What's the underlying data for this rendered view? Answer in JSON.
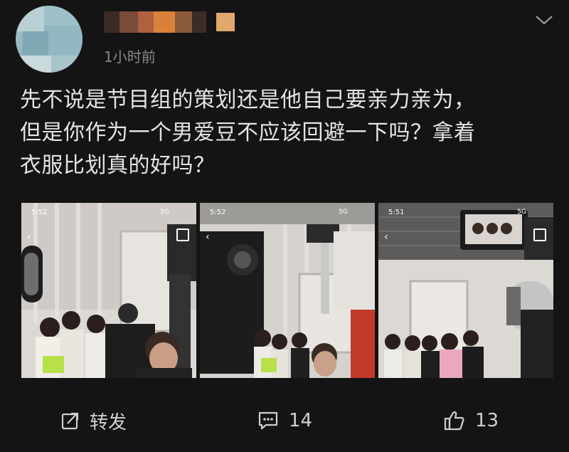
{
  "post": {
    "time": "1小时前",
    "text_lines": [
      "先不说是节目组的策划还是他自己要亲力亲为，",
      "但是你作为一个男爱豆不应该回避一下吗？拿着",
      "衣服比划真的好吗？"
    ]
  },
  "photos": [
    {
      "status_time": "5:52",
      "signal": "5G"
    },
    {
      "status_time": "5:52",
      "signal": "5G"
    },
    {
      "status_time": "5:51",
      "signal": "5G"
    }
  ],
  "actions": {
    "repost_label": "转发",
    "comment_count": "14",
    "like_count": "13"
  },
  "icons": {
    "chevron": "chevron-down-icon",
    "repost": "repost-icon",
    "comment": "comment-icon",
    "like": "thumbs-up-icon"
  },
  "colors": {
    "background": "#141414",
    "text": "#e4e4e4",
    "muted": "#8a8a8a"
  }
}
